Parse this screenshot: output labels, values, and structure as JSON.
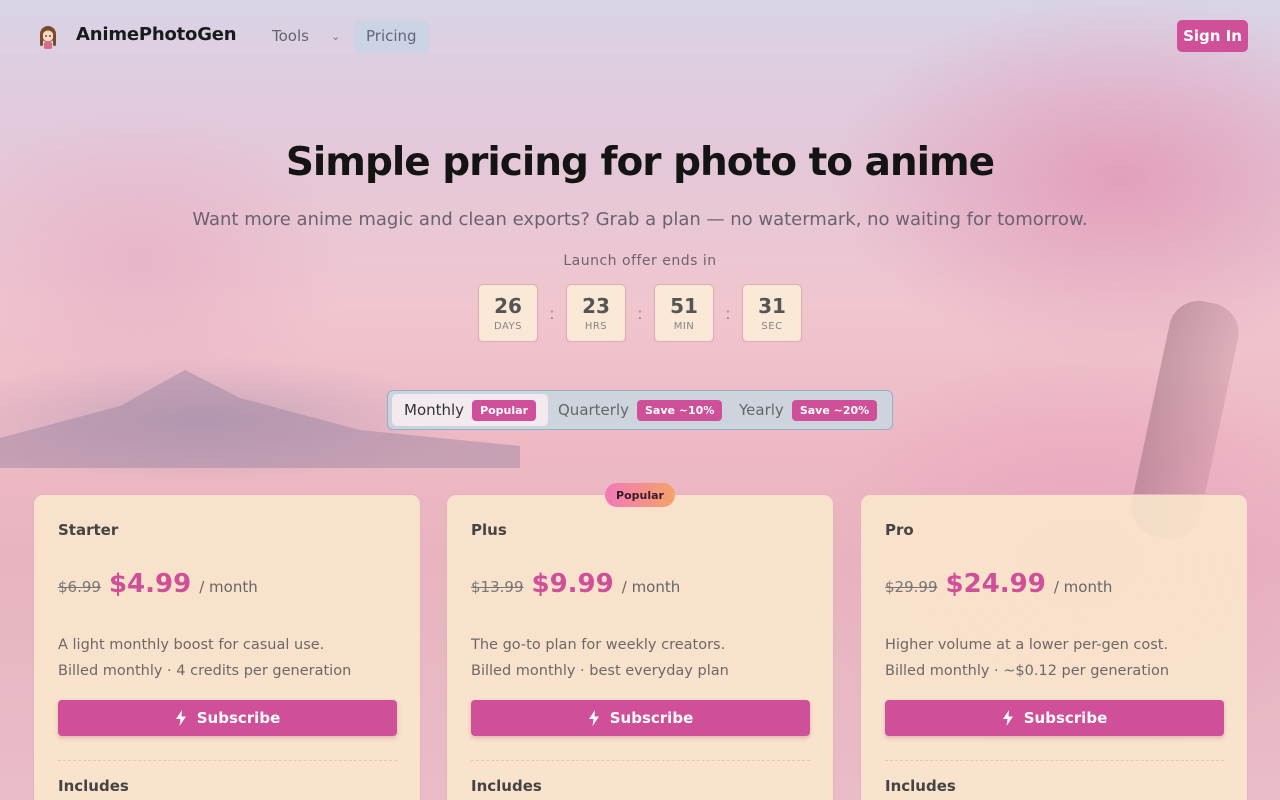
{
  "header": {
    "brand": "AnimePhotoGen",
    "tools_label": "Tools",
    "pricing_label": "Pricing",
    "signin_label": "Sign In"
  },
  "hero": {
    "title": "Simple pricing for photo to anime",
    "subtitle": "Want more anime magic and clean exports? Grab a plan — no watermark, no waiting for tomorrow.",
    "offer_label": "Launch offer ends in"
  },
  "countdown": [
    {
      "value": "26",
      "unit": "DAYS"
    },
    {
      "value": "23",
      "unit": "HRS"
    },
    {
      "value": "51",
      "unit": "MIN"
    },
    {
      "value": "31",
      "unit": "SEC"
    }
  ],
  "countdown_separator": ":",
  "period_toggle": {
    "selected": "Monthly",
    "options": [
      {
        "label": "Monthly",
        "badge": "Popular"
      },
      {
        "label": "Quarterly",
        "badge": "Save ~10%"
      },
      {
        "label": "Yearly",
        "badge": "Save ~20%"
      }
    ]
  },
  "popular_tag": "Popular",
  "plans": [
    {
      "name": "Starter",
      "old_price": "$6.99",
      "price": "$4.99",
      "per": "/ month",
      "desc1": "A light monthly boost for casual use.",
      "desc2": "Billed monthly · 4 credits per generation",
      "cta": "Subscribe",
      "includes": "Includes"
    },
    {
      "name": "Plus",
      "old_price": "$13.99",
      "price": "$9.99",
      "per": "/ month",
      "desc1": "The go-to plan for weekly creators.",
      "desc2": "Billed monthly · best everyday plan",
      "cta": "Subscribe",
      "includes": "Includes"
    },
    {
      "name": "Pro",
      "old_price": "$29.99",
      "price": "$24.99",
      "per": "/ month",
      "desc1": "Higher volume at a lower per-gen cost.",
      "desc2": "Billed monthly · ~$0.12 per generation",
      "cta": "Subscribe",
      "includes": "Includes"
    }
  ],
  "icons": {
    "logo": "anime-girl-logo-icon",
    "tools_chevron": "chevron-down-icon",
    "subscribe": "lightning-bolt-icon"
  },
  "colors": {
    "accent": "#cf4f98",
    "card_bg": "#fae8cd",
    "toggle_bg": "#c3dce6"
  }
}
